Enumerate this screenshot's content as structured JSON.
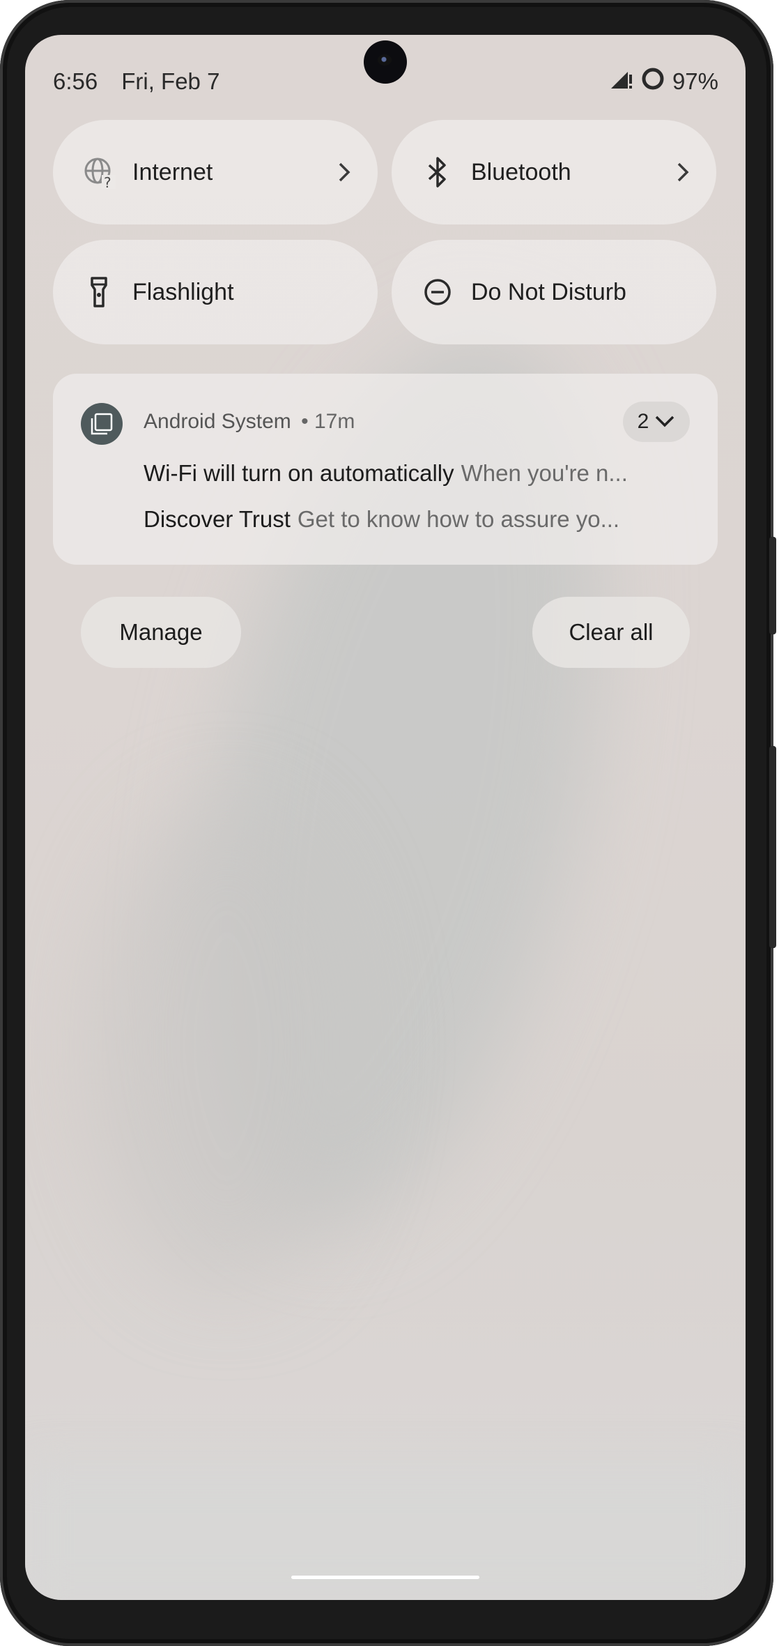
{
  "status_bar": {
    "time": "6:56",
    "date": "Fri, Feb 7",
    "battery": "97%",
    "signal_icon": "cell-signal-warning-icon",
    "battery_icon": "battery-ring-icon"
  },
  "quick_settings": {
    "tiles": [
      {
        "label": "Internet",
        "icon": "globe-question-icon",
        "has_chevron": true
      },
      {
        "label": "Bluetooth",
        "icon": "bluetooth-icon",
        "has_chevron": true
      },
      {
        "label": "Flashlight",
        "icon": "flashlight-icon",
        "has_chevron": false
      },
      {
        "label": "Do Not Disturb",
        "icon": "do-not-disturb-icon",
        "has_chevron": false
      }
    ]
  },
  "notification": {
    "app_name": "Android System",
    "time_ago": "• 17m",
    "count": "2",
    "items": [
      {
        "title": "Wi-Fi will turn on automatically",
        "body": "When you're n..."
      },
      {
        "title": "Discover Trust",
        "body": "Get to know how to assure yo..."
      }
    ]
  },
  "actions": {
    "manage": "Manage",
    "clear_all": "Clear all"
  },
  "colors": {
    "shade_background": "#dcd5d2",
    "tile_background": "#f0edeb",
    "app_icon_bg": "#4f5a5c"
  }
}
